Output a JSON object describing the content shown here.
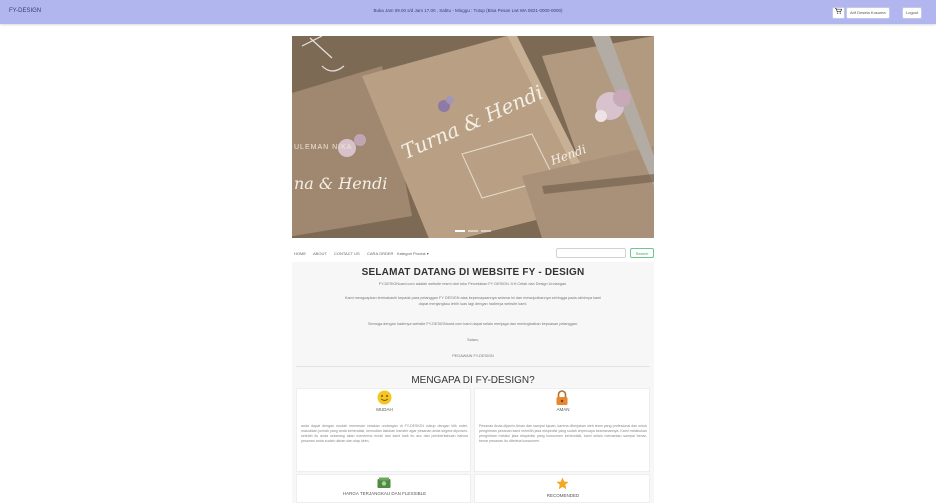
{
  "topbar": {
    "brand": "FY-DESIGN",
    "hours": "Buka Jam 09.00 s/d Jam 17.00 , Sabtu - Minggu : Tutup (Bisa Pesan Lwt WA 0821-0000-0000)",
    "account_label": "Arif Deseta Kosuma",
    "logout_label": "Logout",
    "cart_icon": "cart-icon"
  },
  "hero": {
    "image_icon": "wedding-invitation-photo",
    "text_main": "Turna & Hendi",
    "text_left": "na & Hendi",
    "text_right": "Hendi",
    "text_top": "ULEMAN NIKA"
  },
  "nav": {
    "items": [
      "HOME",
      "ABOUT",
      "CONTACT US",
      "CARA ORDER",
      "Kategori Produk ▾"
    ],
    "search_placeholder": "",
    "search_label": "Search"
  },
  "welcome": {
    "title": "SELAMAT DATANG DI WEBSITE FY - DESIGN",
    "lines": [
      "FY-DESIGNcard.com adalah website resmi dari toko Percetakan FY DESIGN Jl.H.Cetak dan Design Undangan.",
      "Kami menguapkan terimakasih kepada para pelanggan FY DESIGN atas kepercayaannya selama ini dan mewujudkannya sehingga pada akhirnya kami",
      "dapat menjangkau lebih luas lagi dengan hadirnya website kami.",
      "Semoga dengan hadirnya website FY-DESIGNcard.com kami dapat selalu menjaga dan meningkatkan kepuasan pelanggan.",
      "Salam,",
      "PEGAWAIN FY-DESIGN"
    ]
  },
  "why": {
    "title": "MENGAPA DI FY-DESIGN?",
    "features": [
      {
        "icon": "smiley-icon",
        "title": "MUDAH",
        "text": "anda dapat dengan mudah memesan cetakan undangan di FY-DESIGN cukup dengan klik order, masukkan jumlah yang anda kehendaki, kemudian lakukan transfer agar pesanan anda segera diproses. setelah itu anda sekarang akan menerima email dari kami baik itu acc dan pemberitahuan bahwa pesanan anda sudah ukiran dan siap kirim."
      },
      {
        "icon": "lock-icon",
        "title": "AMAN",
        "text": "Pesanan Anda dijamin Aman dan sampai tujuan, karena dikerjakan oleh team yang profesional dan untuk pengiriman pesanan kami memilih jasa ekspedisi yang sudah terpercaya keamanannya. Kami melakukan pengiriman melalui jasa ekspedisi yang konsumen kehendaki, kami selalu memantau sampai benar-benar pesanan itu diterima konsumen."
      },
      {
        "icon": "money-icon",
        "title": "HARGA TERJANGKAU DAN FLEXSIBLE",
        "text": ""
      },
      {
        "icon": "star-icon",
        "title": "RECOMENDED",
        "text": ""
      }
    ]
  },
  "colors": {
    "topbar": "#b1b6ef",
    "search_button": "#3da864"
  }
}
